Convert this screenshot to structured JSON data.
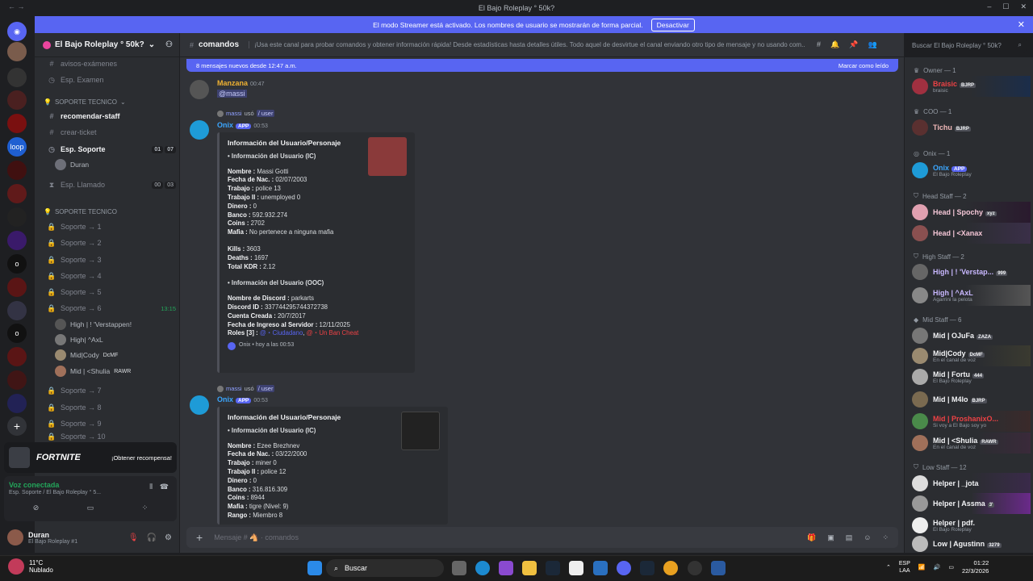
{
  "window": {
    "title": "El Bajo Roleplay ° 50k?"
  },
  "streamer": {
    "text": "El modo Streamer está activado. Los nombres de usuario se mostrarán de forma parcial.",
    "button": "Desactivar"
  },
  "guild": {
    "name": "El Bajo Roleplay ° 50k?"
  },
  "channels": {
    "c1": "avisos-exámenes",
    "c2": "Esp. Examen",
    "cat1": "SOPORTE TECNICO",
    "c3": "recomendar-staff",
    "c4": "crear-ticket",
    "c5": "Esp. Soporte",
    "c5a": "01",
    "c5b": "07",
    "u1": "Duran",
    "c6": "Esp. Llamado",
    "c6a": "00",
    "c6b": "03",
    "cat2": "SOPORTE TECNICO",
    "s1": "Soporte → 1",
    "s2": "Soporte → 2",
    "s3": "Soporte → 3",
    "s4": "Soporte → 4",
    "s5": "Soporte → 5",
    "s6": "Soporte → 6",
    "s6time": "13:15",
    "v1": "High | ! 'Verstappen!",
    "v2": "High| ^AxL",
    "v3": "Mid|Cody",
    "v3tag": "DcMF",
    "v4": "Mid | <Shulia",
    "v4tag": "RAWR",
    "s7": "Soporte → 7",
    "s8": "Soporte → 8",
    "s9": "Soporte → 9",
    "s10": "Soporte → 10"
  },
  "promo": {
    "name": "FORTNITE",
    "cta": "¡Obtener recompensa!"
  },
  "voice": {
    "status": "Voz conectada",
    "channel": "Esp. Soporte / El Bajo Roleplay ° 5..."
  },
  "user": {
    "name": "Duran",
    "status": "El Bajo Roleplay #1"
  },
  "chat": {
    "channel": "comandos",
    "topic": "¡Usa este canal para probar comandos y obtener información rápida! Desde estadísticas hasta detalles útiles. Todo aquel de desvirtue el canal enviando otro tipo de mensaje y no usando com...",
    "search": "Buscar El Bajo Roleplay ° 50k?",
    "newbar": "8 mensajes nuevos desde 12:47 a.m.",
    "markread": "Marcar como leído",
    "composer": "Mensaje # 🐴 · comandos"
  },
  "m1": {
    "author": "Manzana",
    "time": "00:47",
    "text": "@massi"
  },
  "m2": {
    "replyuser": "massi",
    "used": "usó",
    "cmd": "/ user",
    "author": "Onix",
    "badge": "APP",
    "time": "00:53",
    "title": "Información del Usuario/Personaje",
    "sec1": "Información del Usuario (IC)",
    "fields": [
      [
        "Nombre :",
        "Massi Gotti"
      ],
      [
        "Fecha de Nac. :",
        "02/07/2003"
      ],
      [
        "Trabajo :",
        "police 13"
      ],
      [
        "Trabajo II :",
        "unemployed 0"
      ],
      [
        "Dinero :",
        "0"
      ],
      [
        "Banco :",
        "592.932.274"
      ],
      [
        "Coins :",
        "2702"
      ],
      [
        "Mafia :",
        "No pertenece a ninguna mafia"
      ]
    ],
    "stats": [
      [
        "Kills :",
        "3603"
      ],
      [
        "Deaths :",
        "1697"
      ],
      [
        "Total KDR :",
        "2.12"
      ]
    ],
    "sec2": "Información del Usuario (OOC)",
    "ooc": [
      [
        "Nombre de Discord :",
        "parkarts"
      ],
      [
        "Discord ID :",
        "337744295744372738"
      ],
      [
        "Cuenta Creada :",
        "20/7/2017"
      ],
      [
        "Fecha de Ingreso al Servidor :",
        "12/11/2025"
      ]
    ],
    "roles_label": "Roles [3] :",
    "role1": "@・Ciudadano",
    "role2": "@・Un Ban Cheat",
    "footer": "Onix • hoy a las 00:53"
  },
  "m3": {
    "replyuser": "massi",
    "used": "usó",
    "cmd": "/ user",
    "author": "Onix",
    "badge": "APP",
    "time": "00:53",
    "title": "Información del Usuario/Personaje",
    "sec1": "Información del Usuario (IC)",
    "fields": [
      [
        "Nombre :",
        "Ezee Brezhnev"
      ],
      [
        "Fecha de Nac. :",
        "03/22/2000"
      ],
      [
        "Trabajo :",
        "miner 0"
      ],
      [
        "Trabajo II :",
        "police 12"
      ],
      [
        "Dinero :",
        "0"
      ],
      [
        "Banco :",
        "316.816.309"
      ],
      [
        "Coins :",
        "8944"
      ],
      [
        "Mafia :",
        "tigre (Nivel: 9)"
      ],
      [
        "Rango :",
        "Miembro 8"
      ]
    ]
  },
  "members": {
    "g1": "Owner — 1",
    "m1": "Braisic",
    "m1t": "BJRP",
    "m1s": "braisic",
    "g2": "COO — 1",
    "m2": "Tichu",
    "m2t": "BJRP",
    "g3": "Onix — 1",
    "m3": "Onix",
    "m3t": "APP",
    "m3s": "El Bajo Roleplay",
    "g4": "Head Staff — 2",
    "m4": "Head | Spochy",
    "m4t": "xyz",
    "m5": "Head | <Xanax",
    "g5": "High Staff — 2",
    "m6": "High | ! 'Verstap...",
    "m6t": "999",
    "m7": "High | ^AxL",
    "m7s": "Agarrini la pelota",
    "g6": "Mid Staff — 6",
    "m8": "Mid | OJuFa",
    "m8t": "ZAZA",
    "m9": "Mid|Cody",
    "m9t": "DcMF",
    "m9s": "En el canal de voz",
    "m10": "Mid | Fortu",
    "m10t": "444",
    "m10s": "El Bajo Roleplay",
    "m11": "Mid | M4lo",
    "m11t": "BJRP",
    "m12": "Mid | ProshanixO...",
    "m12s": "Si voy a El Bajo soy yo",
    "m13": "Mid | <Shulia",
    "m13t": "RAWR",
    "m13s": "En el canal de voz",
    "g7": "Low Staff — 12",
    "m14": "Helper | _jota",
    "m15": "Helper | Assma",
    "m15t": "3'",
    "m16": "Helper | pdf.",
    "m16s": "El Bajo Roleplay",
    "m17": "Low | Agustinn",
    "m17t": "3279"
  },
  "taskbar": {
    "temp": "11°C",
    "weather": "Nublado",
    "search": "Buscar",
    "lang": "ESP",
    "lang2": "LAA",
    "time": "01:22",
    "date": "22/3/2026"
  }
}
